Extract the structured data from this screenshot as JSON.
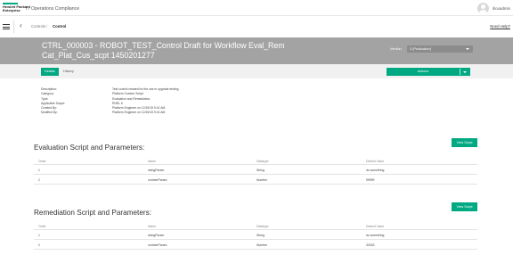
{
  "header": {
    "brand_line1": "Hewlett Packard",
    "brand_line2": "Enterprise",
    "app_title": "IT Operations Compliance",
    "username": "ihooadmin",
    "brand_color": "#01a982"
  },
  "nav": {
    "breadcrumb_root": "Controls",
    "breadcrumb_current": "Control",
    "help_link": "Need Help?"
  },
  "banner": {
    "title": "CTRL_000003 - ROBOT_TEST_Control Draft for Workflow Eval_Rem Cat_Plat_Cus_scpt 1450201277",
    "version_label": "Version",
    "version_value": "2 (Production)"
  },
  "tabs": {
    "details": "Details",
    "history": "History",
    "actions": "Actions"
  },
  "meta": [
    {
      "label": "Description:",
      "value": "Test control created for the use in upgrade testing"
    },
    {
      "label": "Category:",
      "value": "Platform Custom Script"
    },
    {
      "label": "Type:",
      "value": "Evaluation and Remediation"
    },
    {
      "label": "Applicable Scope:",
      "value": "RHEL 6"
    },
    {
      "label": "Created By:",
      "value": "Platform Engineer on 12/15/15 9:41 AM"
    },
    {
      "label": "Modified By:",
      "value": "Platform Engineer on 12/15/15 9:41 AM"
    }
  ],
  "evaluation": {
    "title": "Evaluation Script and Parameters:",
    "view_button": "View Script",
    "columns": [
      "Order",
      "Name",
      "Datatype",
      "Default Value"
    ],
    "rows": [
      [
        "1",
        "stringParam",
        "String",
        "do something"
      ],
      [
        "2",
        "numberParam",
        "Number",
        "99999"
      ]
    ]
  },
  "remediation": {
    "title": "Remediation Script and Parameters:",
    "view_button": "View Script",
    "columns": [
      "Order",
      "Name",
      "Datatype",
      "Default Value"
    ],
    "rows": [
      [
        "1",
        "stringParam",
        "String",
        "do something"
      ],
      [
        "2",
        "numberParam",
        "Number",
        "33333"
      ]
    ]
  }
}
